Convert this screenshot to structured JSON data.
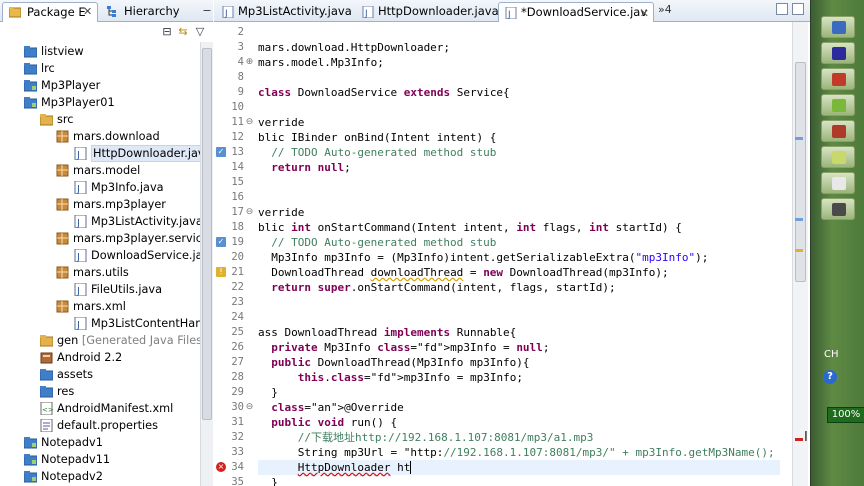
{
  "left_panel": {
    "tabs": [
      {
        "label": "Package E",
        "icon": "package-explorer-icon"
      },
      {
        "label": "Hierarchy",
        "icon": "hierarchy-icon"
      }
    ],
    "tree": [
      {
        "label": "listview",
        "icon": "folder-icon",
        "depth": 1
      },
      {
        "label": "lrc",
        "icon": "folder-icon",
        "depth": 1
      },
      {
        "label": "Mp3Player",
        "icon": "project-icon",
        "depth": 1
      },
      {
        "label": "Mp3Player01",
        "icon": "project-icon",
        "depth": 1
      },
      {
        "label": "src",
        "icon": "source-folder-icon",
        "depth": 2
      },
      {
        "label": "mars.download",
        "icon": "package-icon",
        "depth": 3
      },
      {
        "label": "HttpDownloader.java",
        "icon": "java-file-icon",
        "depth": 4,
        "selected": true
      },
      {
        "label": "mars.model",
        "icon": "package-icon",
        "depth": 3
      },
      {
        "label": "Mp3Info.java",
        "icon": "java-file-icon",
        "depth": 4
      },
      {
        "label": "mars.mp3player",
        "icon": "package-icon",
        "depth": 3
      },
      {
        "label": "Mp3ListActivity.java",
        "icon": "java-file-icon",
        "depth": 4
      },
      {
        "label": "mars.mp3player.service",
        "icon": "package-icon",
        "depth": 3
      },
      {
        "label": "DownloadService.java",
        "icon": "java-file-icon",
        "depth": 4
      },
      {
        "label": "mars.utils",
        "icon": "package-icon",
        "depth": 3
      },
      {
        "label": "FileUtils.java",
        "icon": "java-file-icon",
        "depth": 4
      },
      {
        "label": "mars.xml",
        "icon": "package-icon",
        "depth": 3
      },
      {
        "label": "Mp3ListContentHandle",
        "icon": "java-file-icon",
        "depth": 4
      },
      {
        "label": "gen",
        "extra": "[Generated Java Files]",
        "icon": "source-folder-icon",
        "depth": 2
      },
      {
        "label": "Android 2.2",
        "icon": "library-icon",
        "depth": 2
      },
      {
        "label": "assets",
        "icon": "folder-icon",
        "depth": 2
      },
      {
        "label": "res",
        "icon": "folder-icon",
        "depth": 2
      },
      {
        "label": "AndroidManifest.xml",
        "icon": "xml-file-icon",
        "depth": 2
      },
      {
        "label": "default.properties",
        "icon": "properties-file-icon",
        "depth": 2
      },
      {
        "label": "Notepadv1",
        "icon": "project-icon",
        "depth": 1
      },
      {
        "label": "Notepadv11",
        "icon": "project-icon",
        "depth": 1
      },
      {
        "label": "Notepadv2",
        "icon": "project-icon",
        "depth": 1
      }
    ]
  },
  "editor": {
    "tabs": [
      {
        "label": "Mp3ListActivity.java",
        "active": false
      },
      {
        "label": "HttpDownloader.java",
        "active": false
      },
      {
        "label": "*DownloadService.jav",
        "active": true
      }
    ],
    "overflow_label": "»4",
    "lines": [
      {
        "num": "2",
        "text": ""
      },
      {
        "num": "3",
        "text": "mars.download.HttpDownloader;"
      },
      {
        "num": "4",
        "text": "mars.model.Mp3Info;"
      },
      {
        "num": "8",
        "text": ""
      },
      {
        "num": "9",
        "text": "class DownloadService extends Service{"
      },
      {
        "num": "10",
        "text": ""
      },
      {
        "num": "11",
        "text": "verride"
      },
      {
        "num": "12",
        "text": "blic IBinder onBind(Intent intent) {"
      },
      {
        "num": "13",
        "text": "  // TODO Auto-generated method stub"
      },
      {
        "num": "14",
        "text": "  return null;"
      },
      {
        "num": "15",
        "text": ""
      },
      {
        "num": "16",
        "text": ""
      },
      {
        "num": "17",
        "text": "verride"
      },
      {
        "num": "18",
        "text": "blic int onStartCommand(Intent intent, int flags, int startId) {"
      },
      {
        "num": "19",
        "text": "  // TODO Auto-generated method stub"
      },
      {
        "num": "20",
        "text": "  Mp3Info mp3Info = (Mp3Info)intent.getSerializableExtra(\"mp3Info\");"
      },
      {
        "num": "21",
        "text": "  DownloadThread downloadThread = new DownloadThread(mp3Info);"
      },
      {
        "num": "22",
        "text": "  return super.onStartCommand(intent, flags, startId);"
      },
      {
        "num": "23",
        "text": ""
      },
      {
        "num": "24",
        "text": ""
      },
      {
        "num": "25",
        "text": "ass DownloadThread implements Runnable{"
      },
      {
        "num": "26",
        "text": "  private Mp3Info mp3Info = null;"
      },
      {
        "num": "27",
        "text": "  public DownloadThread(Mp3Info mp3Info){"
      },
      {
        "num": "28",
        "text": "      this.mp3Info = mp3Info;"
      },
      {
        "num": "29",
        "text": "  }"
      },
      {
        "num": "30",
        "text": "  @Override"
      },
      {
        "num": "31",
        "text": "  public void run() {"
      },
      {
        "num": "32",
        "text": "      //下载地址http://192.168.1.107:8081/mp3/a1.mp3"
      },
      {
        "num": "33",
        "text": "      String mp3Url = \"http://192.168.1.107:8081/mp3/\" + mp3Info.getMp3Name();"
      },
      {
        "num": "34",
        "text": "      HttpDownloader ht"
      },
      {
        "num": "35",
        "text": "  }"
      },
      {
        "num": "36",
        "text": ""
      }
    ]
  },
  "taskbar": {
    "input_indicator": "CH",
    "zoom": "100%",
    "help_glyph": "?"
  }
}
